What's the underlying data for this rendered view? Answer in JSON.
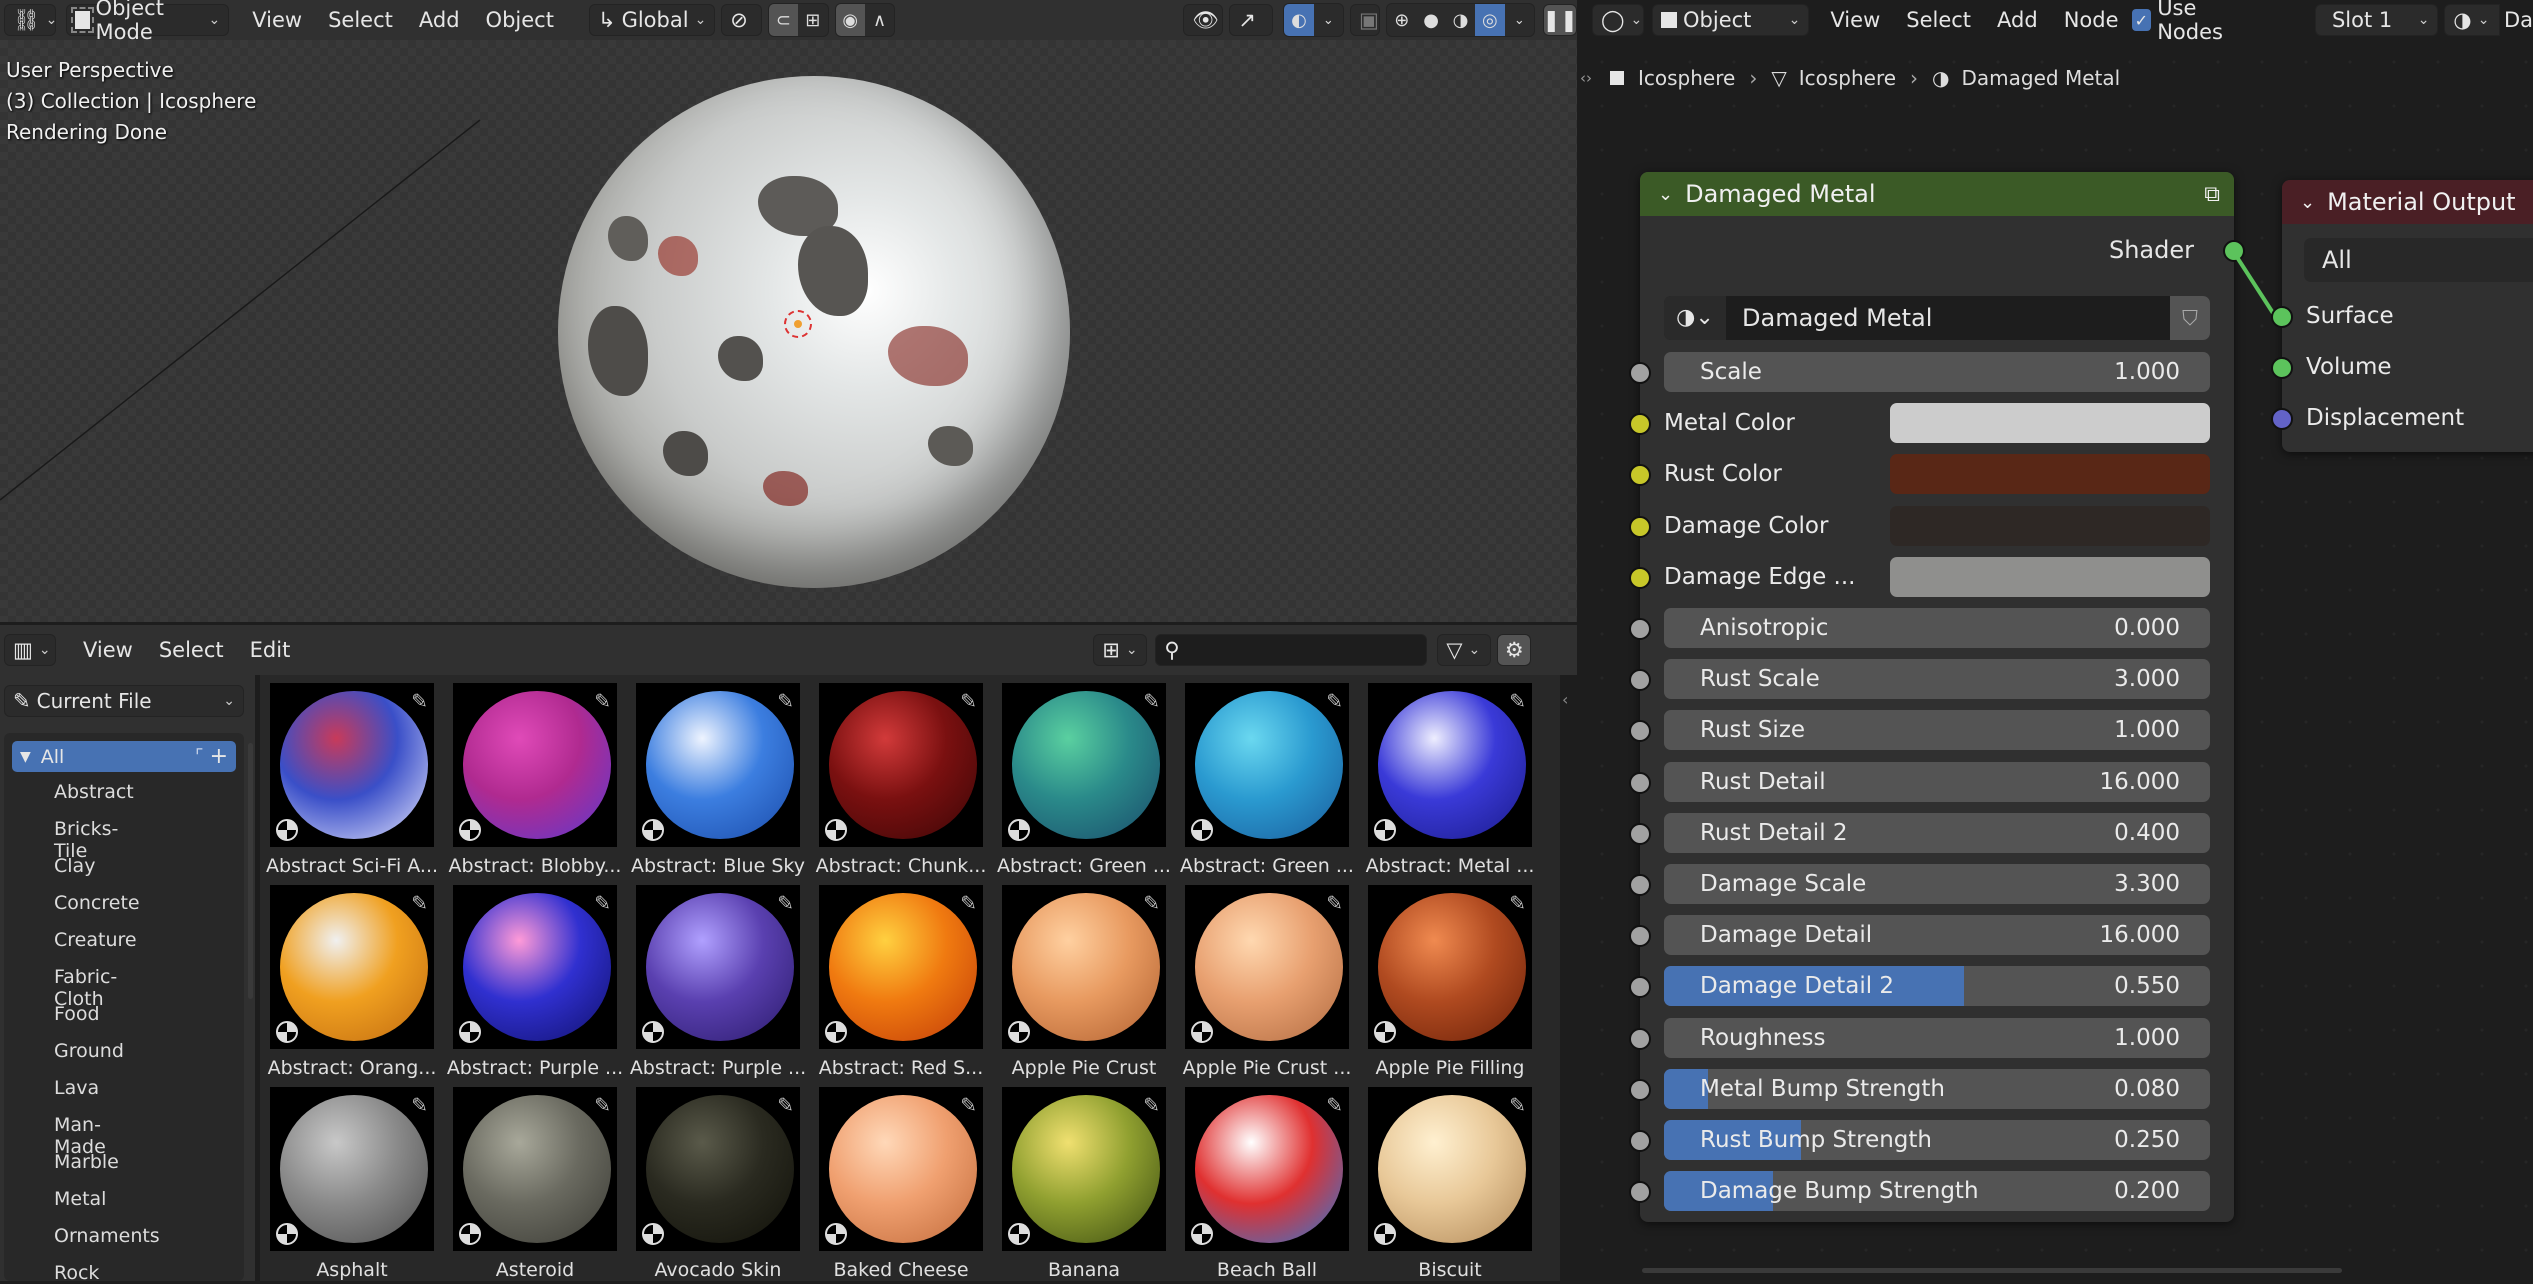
{
  "viewport_header": {
    "editor_type_icon": "3d-viewport-icon",
    "mode": "Object Mode",
    "menus": [
      "View",
      "Select",
      "Add",
      "Object"
    ],
    "orientation": "Global"
  },
  "viewport": {
    "overlay_lines": [
      "User Perspective",
      "(3) Collection | Icosphere",
      "Rendering Done"
    ]
  },
  "node_header": {
    "editor_type_icon": "shader-editor-icon",
    "object_type": "Object",
    "menus": [
      "View",
      "Select",
      "Add",
      "Node"
    ],
    "use_nodes_label": "Use Nodes",
    "use_nodes_checked": true,
    "slot": "Slot 1",
    "material_name_trunc": "Da"
  },
  "breadcrumb": [
    "Icosphere",
    "Icosphere",
    "Damaged Metal"
  ],
  "asset_header": {
    "menus": [
      "View",
      "Select",
      "Edit"
    ],
    "search_placeholder": ""
  },
  "asset_side": {
    "library": "Current File",
    "selected": "All",
    "categories": [
      "Abstract",
      "Bricks-Tile",
      "Clay",
      "Concrete",
      "Creature",
      "Fabric-Cloth",
      "Food",
      "Ground",
      "Lava",
      "Man-Made",
      "Marble",
      "Metal",
      "Ornaments",
      "Rock"
    ]
  },
  "assets": [
    {
      "label": "Abstract Sci-Fi A...",
      "colors": [
        "#c83a5a",
        "#3a4fc8",
        "#e8e8ff"
      ]
    },
    {
      "label": "Abstract: Blobby...",
      "colors": [
        "#e04ab8",
        "#b02a90",
        "#5a3ad0"
      ]
    },
    {
      "label": "Abstract: Blue Sky",
      "colors": [
        "#eef4ff",
        "#3c7ee0",
        "#1a4aa8"
      ]
    },
    {
      "label": "Abstract: Chunk...",
      "colors": [
        "#d23a3a",
        "#7a1010",
        "#3a0606"
      ]
    },
    {
      "label": "Abstract: Green ...",
      "colors": [
        "#5ad0a0",
        "#2a8a8a",
        "#1a4a6a"
      ]
    },
    {
      "label": "Abstract: Green ...",
      "colors": [
        "#6ad8f0",
        "#2a9ad0",
        "#1a5a9a"
      ]
    },
    {
      "label": "Abstract: Metal ...",
      "colors": [
        "#eeeeff",
        "#3a3ad8",
        "#1a1a88"
      ]
    },
    {
      "label": "Abstract: Orang...",
      "colors": [
        "#f0f0f0",
        "#f0a020",
        "#c06a10"
      ]
    },
    {
      "label": "Abstract: Purple ...",
      "colors": [
        "#ff9ad8",
        "#3030d0",
        "#10106a"
      ]
    },
    {
      "label": "Abstract: Purple ...",
      "colors": [
        "#b0a0ff",
        "#5a40b0",
        "#2a1a6a"
      ]
    },
    {
      "label": "Abstract: Red S...",
      "colors": [
        "#ffd040",
        "#f07a10",
        "#c03a08"
      ]
    },
    {
      "label": "Apple Pie Crust",
      "colors": [
        "#ffd0a0",
        "#e89a60",
        "#b06030"
      ]
    },
    {
      "label": "Apple Pie Crust ...",
      "colors": [
        "#ffd8b0",
        "#e8a070",
        "#b06a40"
      ]
    },
    {
      "label": "Apple Pie Filling",
      "colors": [
        "#f08a50",
        "#b04a20",
        "#6a2008"
      ]
    },
    {
      "label": "Asphalt",
      "colors": [
        "#c8c8c8",
        "#8a8a8a",
        "#4a4a4a"
      ]
    },
    {
      "label": "Asteroid",
      "colors": [
        "#a8a89a",
        "#6a6a60",
        "#3a3a34"
      ]
    },
    {
      "label": "Avocado Skin",
      "colors": [
        "#5a5a4a",
        "#2a2a20",
        "#101008"
      ]
    },
    {
      "label": "Baked Cheese",
      "colors": [
        "#ffd8b8",
        "#f0a070",
        "#c06a3a"
      ]
    },
    {
      "label": "Banana",
      "colors": [
        "#f0e070",
        "#90a030",
        "#3a4a10"
      ]
    },
    {
      "label": "Beach Ball",
      "colors": [
        "#ffffff",
        "#e03030",
        "#2a7ad8"
      ]
    },
    {
      "label": "Biscuit",
      "colors": [
        "#fff0d0",
        "#e8c898",
        "#b08858"
      ]
    }
  ],
  "group_node": {
    "title": "Damaged Metal",
    "header_color": "#3b5a26",
    "output_label": "Shader",
    "datablock": "Damaged Metal",
    "inputs": [
      {
        "type": "value",
        "label": "Scale",
        "value": "1.000",
        "fraction": 0
      },
      {
        "type": "color",
        "label": "Metal Color",
        "color": "#cccccc"
      },
      {
        "type": "color",
        "label": "Rust Color",
        "color": "#592716"
      },
      {
        "type": "color",
        "label": "Damage Color",
        "color": "#2e2825"
      },
      {
        "type": "color",
        "label": "Damage Edge ...",
        "color": "#8f8f8d"
      },
      {
        "type": "value",
        "label": "Anisotropic",
        "value": "0.000",
        "fraction": 0
      },
      {
        "type": "value",
        "label": "Rust Scale",
        "value": "3.000",
        "fraction": 0
      },
      {
        "type": "value",
        "label": "Rust Size",
        "value": "1.000",
        "fraction": 0
      },
      {
        "type": "value",
        "label": "Rust Detail",
        "value": "16.000",
        "fraction": 0
      },
      {
        "type": "value",
        "label": "Rust Detail 2",
        "value": "0.400",
        "fraction": 0
      },
      {
        "type": "value",
        "label": "Damage Scale",
        "value": "3.300",
        "fraction": 0
      },
      {
        "type": "value",
        "label": "Damage Detail",
        "value": "16.000",
        "fraction": 0
      },
      {
        "type": "value",
        "label": "Damage Detail 2",
        "value": "0.550",
        "fraction": 0.55
      },
      {
        "type": "value",
        "label": "Roughness",
        "value": "1.000",
        "fraction": 0
      },
      {
        "type": "value",
        "label": "Metal Bump Strength",
        "value": "0.080",
        "fraction": 0.08
      },
      {
        "type": "value",
        "label": "Rust Bump Strength",
        "value": "0.250",
        "fraction": 0.25
      },
      {
        "type": "value",
        "label": "Damage Bump Strength",
        "value": "0.200",
        "fraction": 0.2
      }
    ]
  },
  "output_node": {
    "title": "Material Output",
    "header_color": "#4a1f25",
    "target": "All",
    "inputs": [
      {
        "label": "Surface",
        "socket_color": "#5cc35c"
      },
      {
        "label": "Volume",
        "socket_color": "#5cc35c"
      },
      {
        "label": "Displacement",
        "socket_color": "#6363c7"
      }
    ]
  },
  "colors": {
    "accent": "#4772b3",
    "shader_socket": "#5cc35c",
    "color_socket": "#c7c729",
    "float_socket": "#a1a1a1"
  }
}
